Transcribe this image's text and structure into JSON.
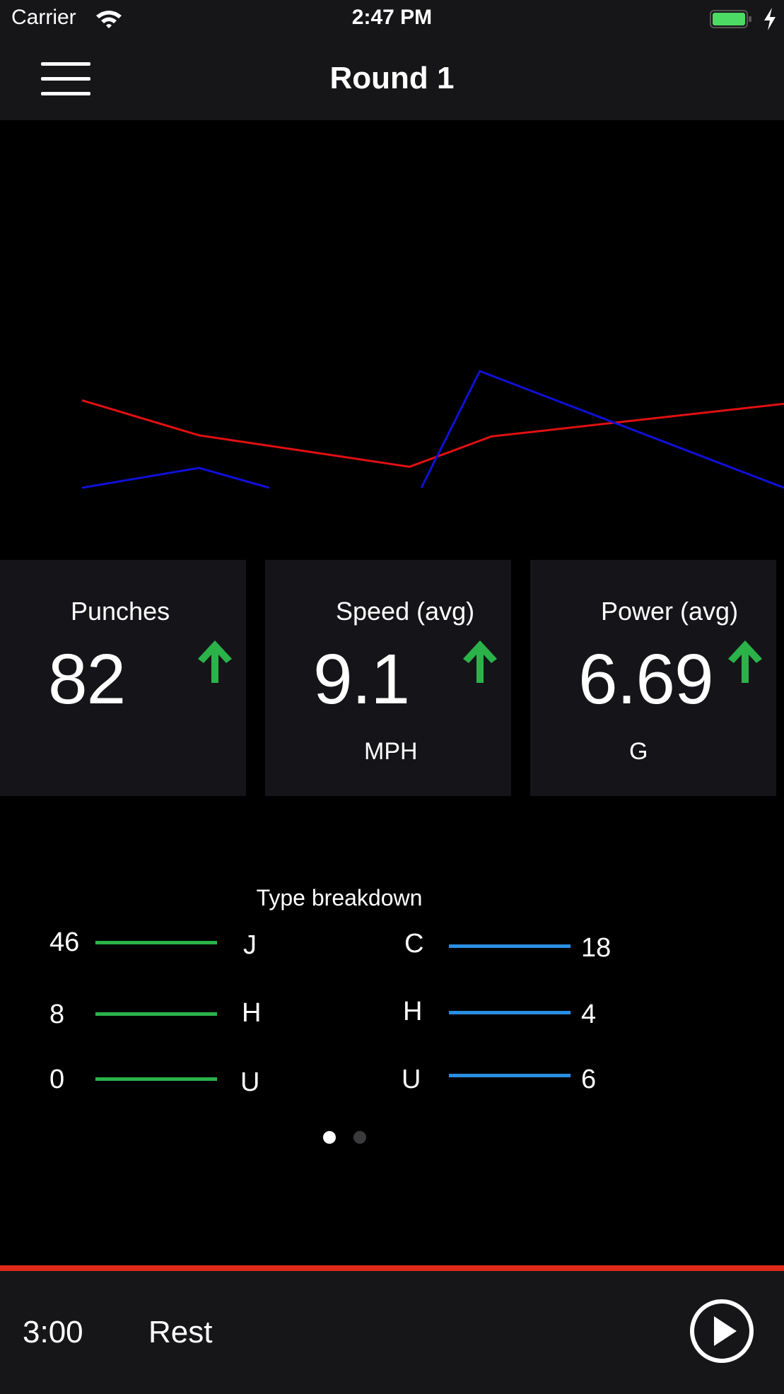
{
  "status": {
    "carrier": "Carrier",
    "time": "2:47 PM"
  },
  "nav": {
    "title": "Round 1"
  },
  "chart_data": {
    "type": "line",
    "series": [
      {
        "color": "#e01010",
        "points": [
          [
            0,
            75
          ],
          [
            1,
            45
          ],
          [
            2,
            30
          ],
          [
            2.8,
            18
          ],
          [
            3.5,
            44
          ],
          [
            6,
            72
          ]
        ]
      },
      {
        "color": "#1010d8",
        "points": [
          [
            0,
            0
          ],
          [
            1,
            17
          ],
          [
            1.6,
            0
          ]
        ],
        "points2": [
          [
            2.9,
            0
          ],
          [
            3.4,
            100
          ],
          [
            6,
            0
          ]
        ]
      }
    ]
  },
  "cards": [
    {
      "title": "Punches",
      "value": "82",
      "unit": ""
    },
    {
      "title": "Speed (avg)",
      "value": "9.1",
      "unit": "MPH"
    },
    {
      "title": "Power (avg)",
      "value": "6.69",
      "unit": "G"
    }
  ],
  "breakdown": {
    "title": "Type breakdown",
    "left": [
      {
        "count": "46",
        "label": "J"
      },
      {
        "count": "8",
        "label": "H"
      },
      {
        "count": "0",
        "label": "U"
      }
    ],
    "right": [
      {
        "label": "C",
        "count": "18"
      },
      {
        "label": "H",
        "count": "4"
      },
      {
        "label": "U",
        "count": "6"
      }
    ]
  },
  "pager": {
    "current": 0,
    "total": 2
  },
  "bottom": {
    "timer": "3:00",
    "rest": "Rest"
  },
  "colors": {
    "accent_red": "#e02a19",
    "green": "#2bb34a",
    "blue": "#2a8ee3"
  }
}
